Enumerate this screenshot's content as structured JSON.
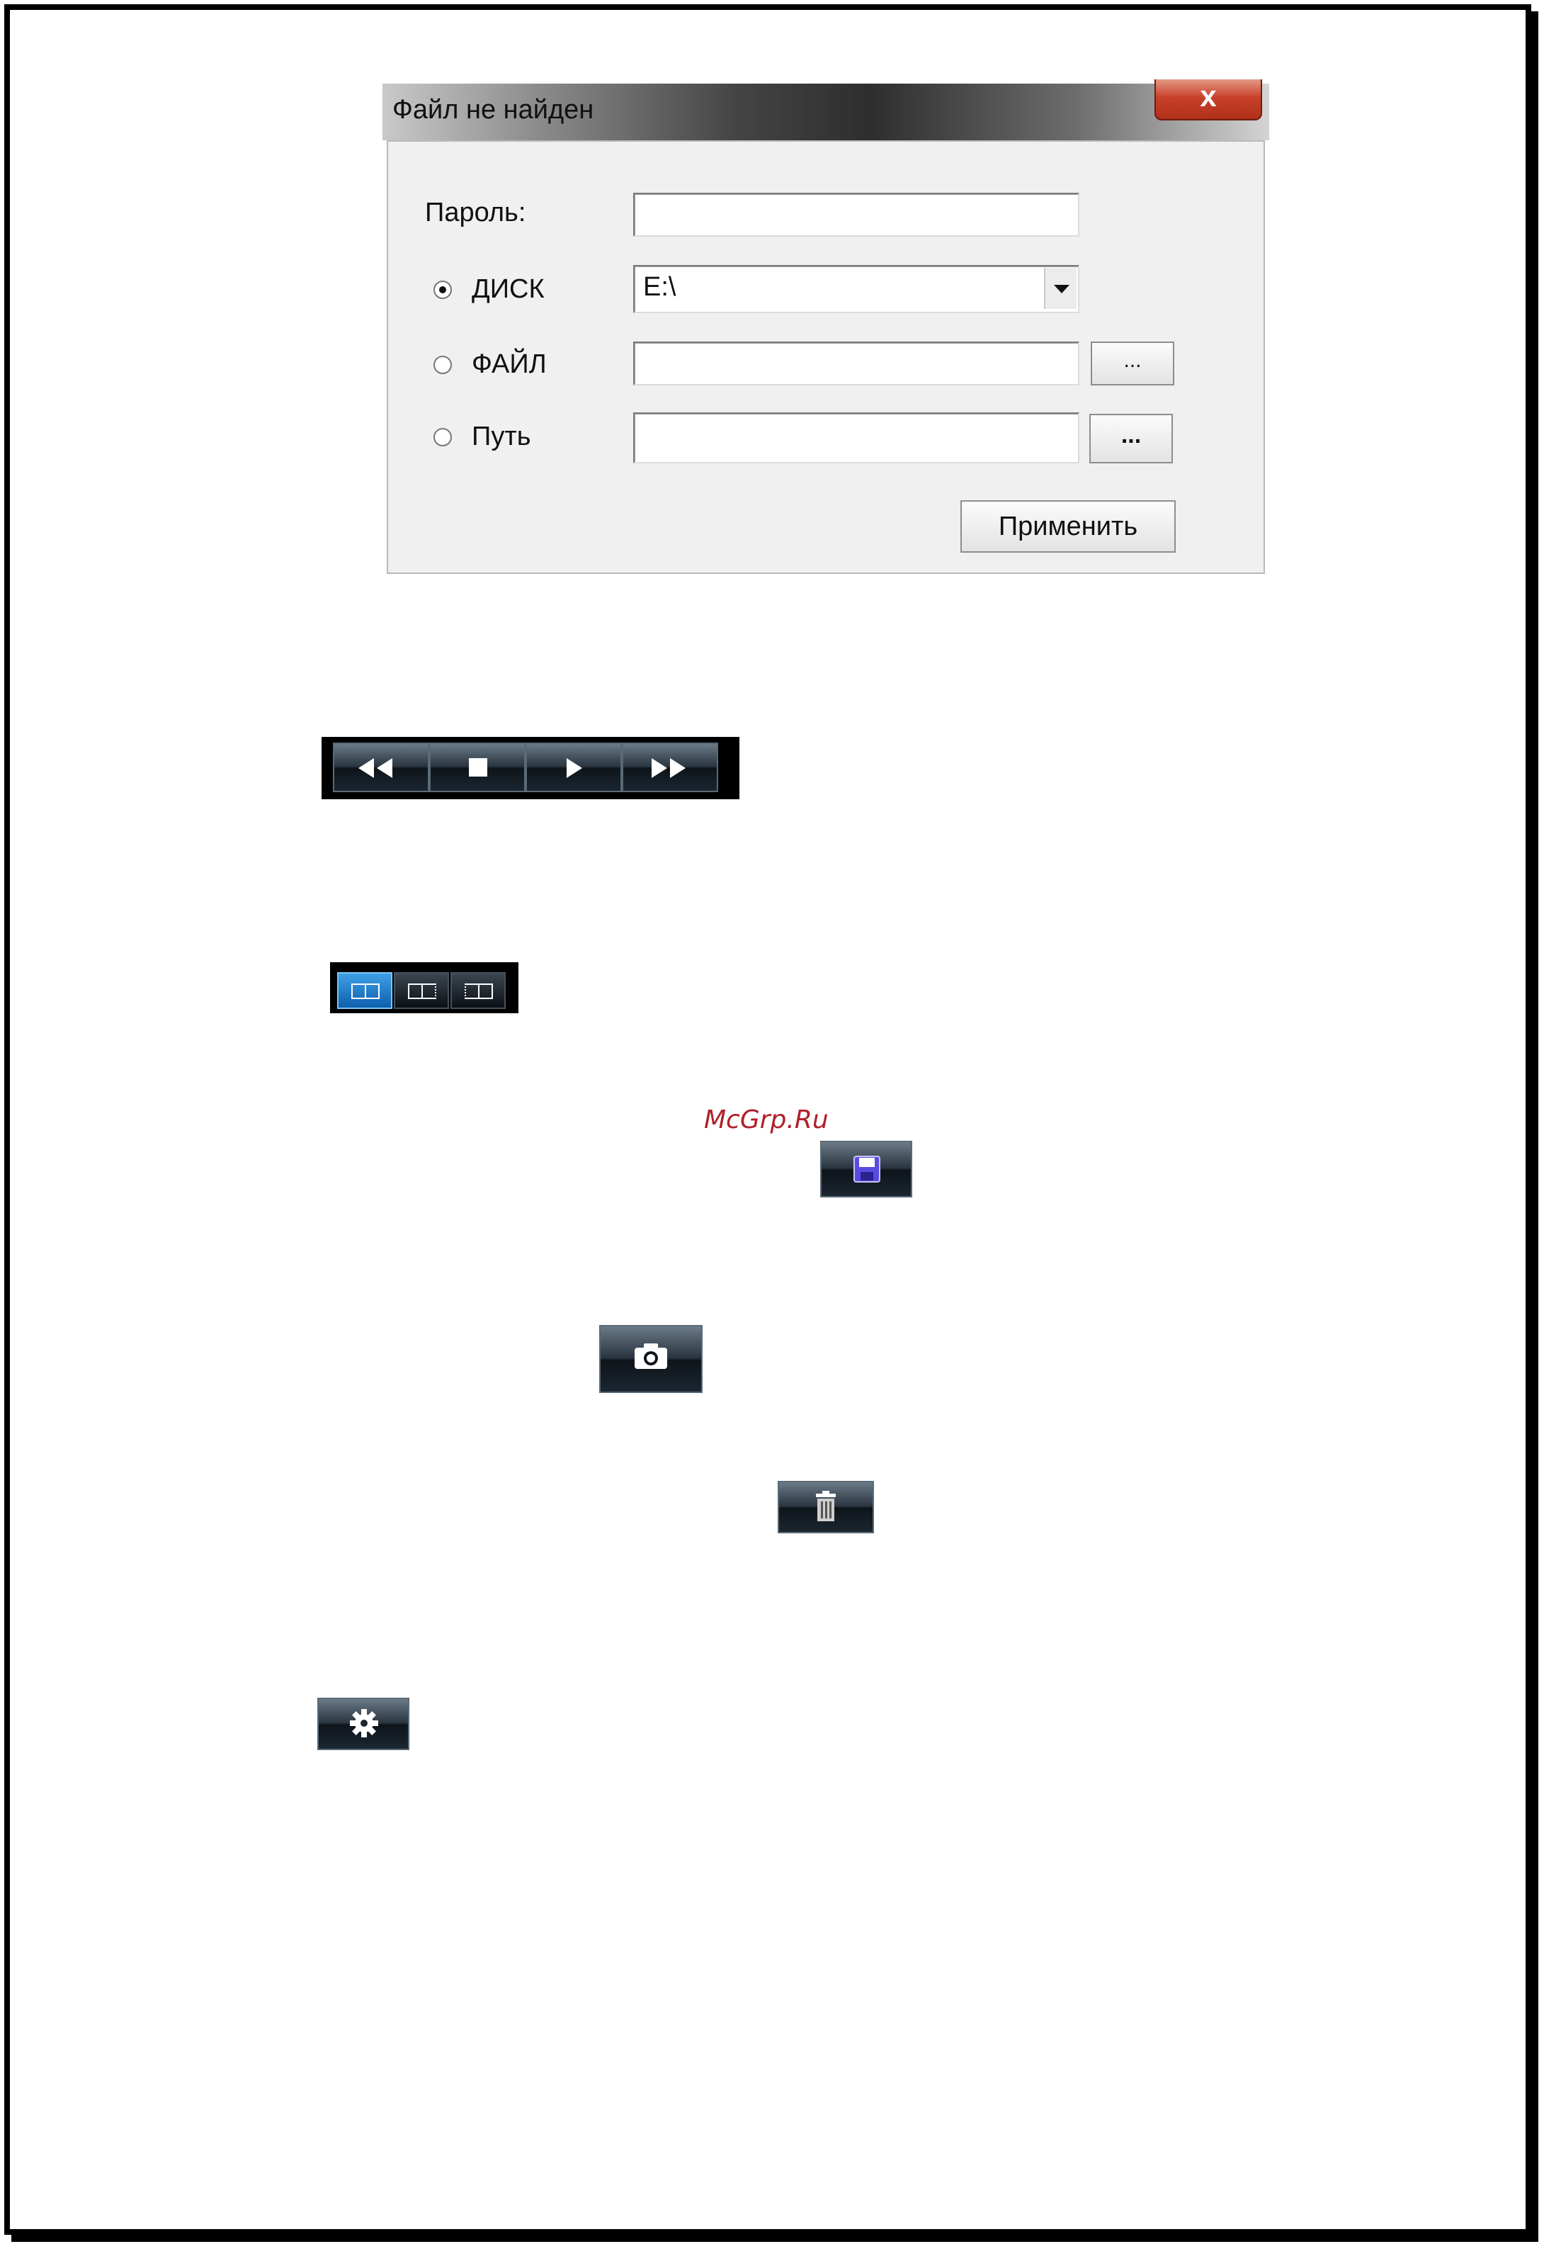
{
  "dialog": {
    "title": "Файл не найден",
    "close_label": "x",
    "password_label": "Пароль:",
    "password_value": "",
    "options": [
      {
        "label": "ДИСК",
        "checked": true
      },
      {
        "label": "ФАЙЛ",
        "checked": false
      },
      {
        "label": "Путь",
        "checked": false
      }
    ],
    "disk_select": {
      "value": "E:\\"
    },
    "file_field_value": "",
    "path_field_value": "",
    "browse_file_label": "...",
    "browse_path_label": "...",
    "apply_label": "Применить"
  },
  "playback_controls": [
    "rewind-icon",
    "stop-icon",
    "play-icon",
    "fast-forward-icon"
  ],
  "view_modes": [
    {
      "icon": "view-mode-both-icon",
      "active": true
    },
    {
      "icon": "view-mode-right-icon",
      "active": false
    },
    {
      "icon": "view-mode-left-icon",
      "active": false
    }
  ],
  "tool_buttons": [
    "save-icon",
    "camera-icon",
    "trash-icon",
    "gear-icon"
  ],
  "watermark": "McGrp.Ru",
  "colors": {
    "dark_button": "#1b2630",
    "active_mode": "#1f78c8",
    "close_button": "#c8412a",
    "watermark": "#b0202a"
  }
}
